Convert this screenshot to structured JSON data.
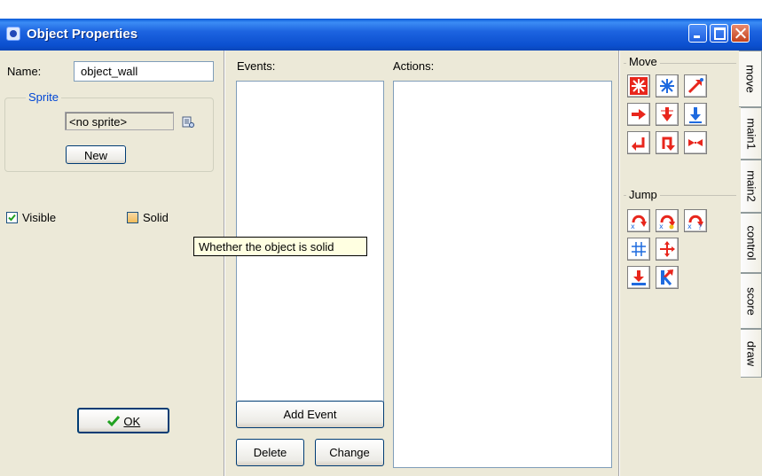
{
  "window": {
    "title": "Object Properties"
  },
  "properties": {
    "name_label": "Name:",
    "name_value": "object_wall",
    "sprite_legend": "Sprite",
    "sprite_value": "<no sprite>",
    "new_button": "New",
    "visible_label": "Visible",
    "visible_checked": true,
    "solid_label": "Solid",
    "solid_checked": false,
    "ok_button": "OK"
  },
  "tooltip": {
    "text": "Whether the object is solid"
  },
  "events": {
    "label": "Events:",
    "items": [],
    "add_button": "Add Event",
    "delete_button": "Delete",
    "change_button": "Change"
  },
  "actions": {
    "label": "Actions:",
    "items": []
  },
  "library": {
    "move_group": "Move",
    "jump_group": "Jump",
    "move_icons": [
      "move-fixed-icon",
      "move-free-icon",
      "move-towards-icon",
      "speed-horizontal-icon",
      "speed-vertical-icon",
      "gravity-icon",
      "reverse-horizontal-icon",
      "reverse-vertical-icon",
      "friction-icon"
    ],
    "jump_icons": [
      "jump-to-position-icon",
      "jump-to-start-icon",
      "jump-to-random-icon",
      "snap-to-grid-icon",
      "wrap-screen-icon",
      "move-to-contact-icon",
      "bounce-icon"
    ],
    "tabs": [
      "move",
      "main1",
      "main2",
      "control",
      "score",
      "draw"
    ],
    "active_tab": "move"
  }
}
